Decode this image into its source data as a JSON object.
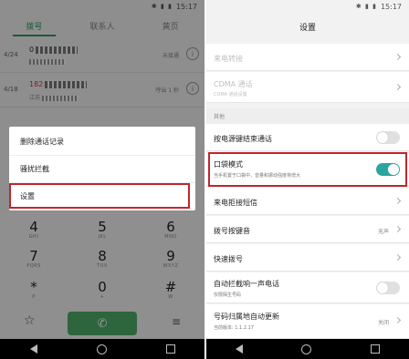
{
  "left": {
    "status_time": "15:17",
    "status_icons": "✱ ▮ ▮",
    "tabs": [
      {
        "label": "拨号",
        "active": true
      },
      {
        "label": "联系人",
        "active": false
      },
      {
        "label": "黄页",
        "active": false
      }
    ],
    "calls": [
      {
        "date": "4/24",
        "number_prefix": "0",
        "status": "未接通"
      },
      {
        "date": "4/18",
        "number_prefix": "182",
        "sub_prefix": "江苏",
        "status": "呼出 1 秒"
      }
    ],
    "menu": [
      {
        "label": "删除通话记录"
      },
      {
        "label": "骚扰拦截"
      },
      {
        "label": "设置"
      }
    ],
    "keys": [
      {
        "digit": "4",
        "letters": "GHI"
      },
      {
        "digit": "5",
        "letters": "JKL"
      },
      {
        "digit": "6",
        "letters": "MNO"
      },
      {
        "digit": "7",
        "letters": "PQRS"
      },
      {
        "digit": "8",
        "letters": "TUV"
      },
      {
        "digit": "9",
        "letters": "WXYZ"
      },
      {
        "digit": "*",
        "letters": "P"
      },
      {
        "digit": "0",
        "letters": "+"
      },
      {
        "digit": "#",
        "letters": "W"
      }
    ],
    "star_icon": "☆",
    "call_icon": "✆",
    "menu_icon": "≡"
  },
  "right": {
    "status_time": "15:17",
    "status_icons": "✱ ▮ ▮",
    "title": "设置",
    "faded_rows": [
      {
        "title": "来电转接"
      },
      {
        "title": "CDMA 通话",
        "sub": "CDMA 通话设置"
      }
    ],
    "section_other": "其他",
    "rows": [
      {
        "title": "按电源键结束通话",
        "type": "toggle",
        "on": false
      },
      {
        "title": "口袋模式",
        "sub": "当手机置于口袋中，音量和振动强度将增大",
        "type": "toggle",
        "on": true
      },
      {
        "title": "来电拒接短信",
        "type": "chevron"
      },
      {
        "title": "拨号按键音",
        "type": "value",
        "value": "无声"
      },
      {
        "title": "快速拨号",
        "type": "chevron"
      },
      {
        "title": "自动拦截响一声电话",
        "sub": "仅限陌生号码",
        "type": "toggle",
        "on": false
      },
      {
        "title": "号码归属地自动更新",
        "sub": "当前版本: 1.1.2.17",
        "type": "value",
        "value": "关闭"
      }
    ]
  }
}
